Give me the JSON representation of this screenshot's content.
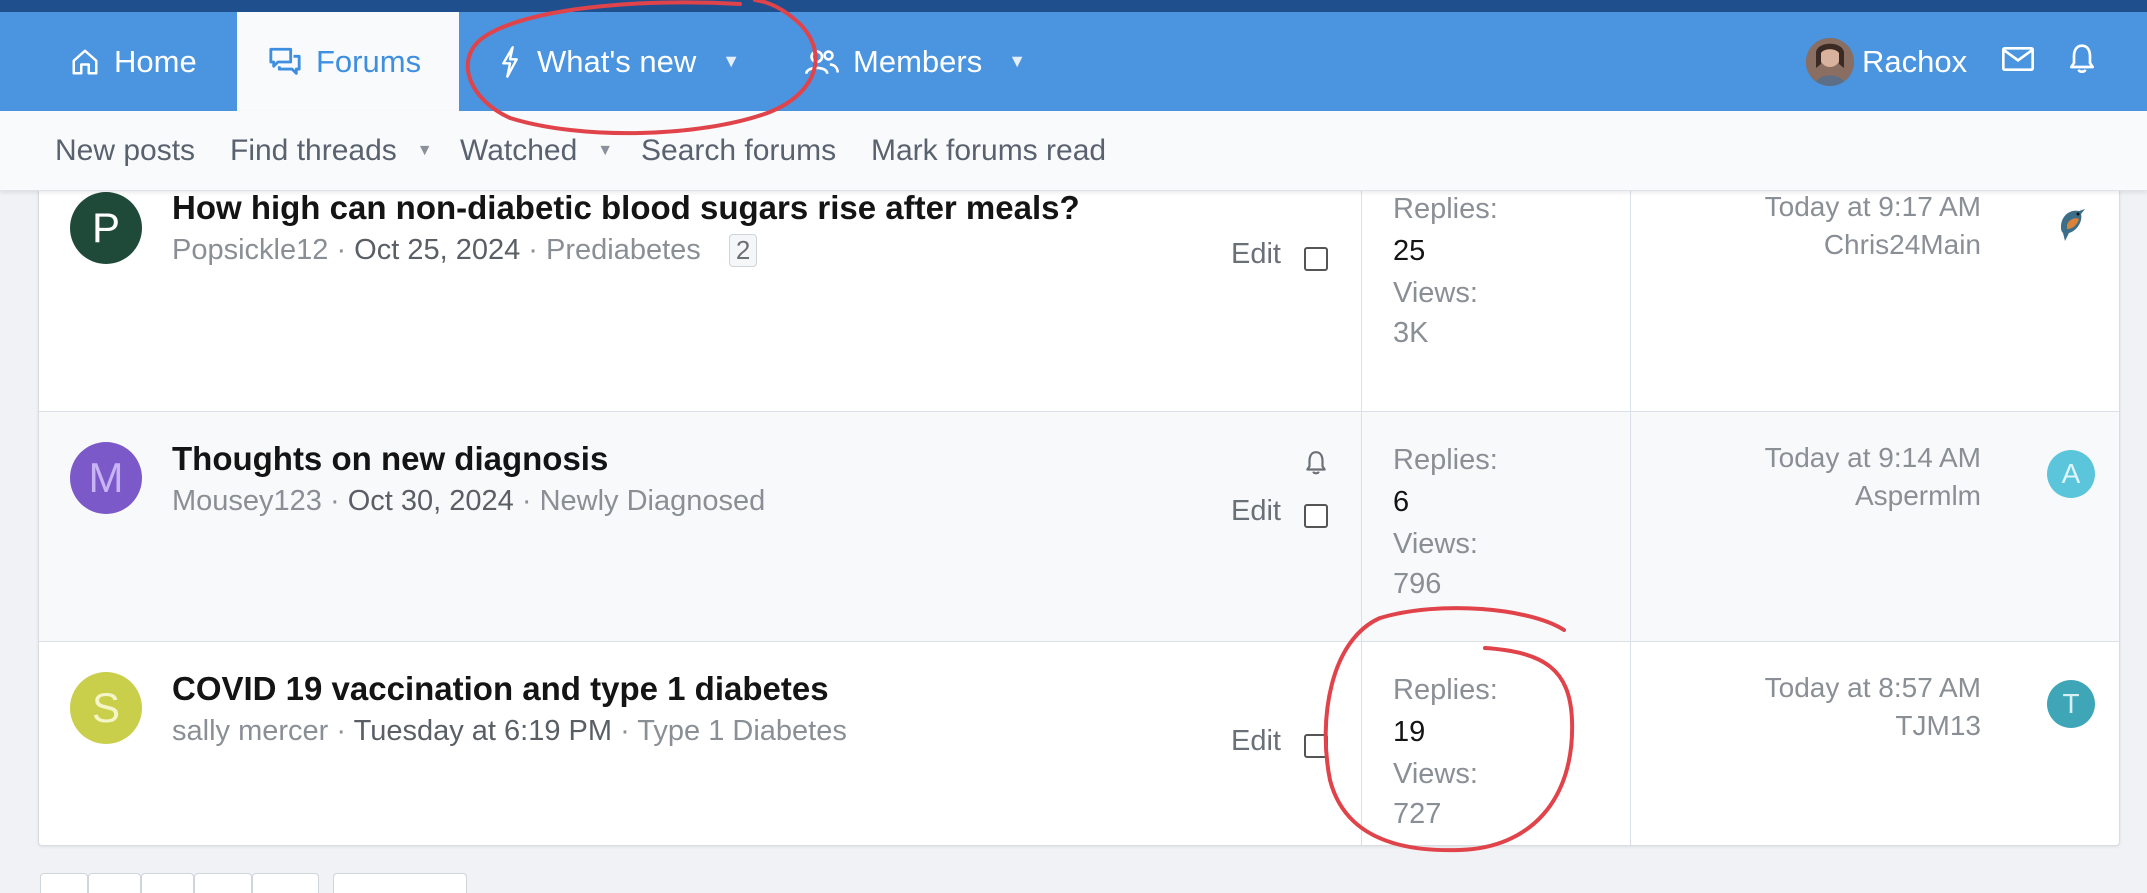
{
  "nav": {
    "tabs": [
      {
        "label": "Home",
        "icon": "home-icon"
      },
      {
        "label": "Forums",
        "icon": "forums-icon",
        "selected": true
      },
      {
        "label": "What's new",
        "icon": "bolt-icon"
      },
      {
        "label": "Members",
        "icon": "members-icon"
      }
    ],
    "user": {
      "name": "Rachox"
    }
  },
  "subnav": {
    "items": [
      "New posts",
      "Find threads",
      "Watched",
      "Search forums",
      "Mark forums read"
    ]
  },
  "threads": [
    {
      "avatar_letter": "P",
      "avatar_color": "#1f4a3a",
      "title": "How high can non-diabetic blood sugars rise after meals?",
      "author": "Popsickle12",
      "date": "Oct 25, 2024",
      "forum": "Prediabetes",
      "pages": "2",
      "edit": "Edit",
      "replies_label": "Replies:",
      "replies": "25",
      "views_label": "Views:",
      "views": "3K",
      "last_time": "Today at 9:17 AM",
      "last_user": "Chris24Main"
    },
    {
      "avatar_letter": "M",
      "avatar_color": "#7b59c9",
      "title": "Thoughts on new diagnosis",
      "author": "Mousey123",
      "date": "Oct 30, 2024",
      "forum": "Newly Diagnosed",
      "edit": "Edit",
      "replies_label": "Replies:",
      "replies": "6",
      "views_label": "Views:",
      "views": "796",
      "last_time": "Today at 9:14 AM",
      "last_user": "Aspermlm",
      "last_avatar_letter": "A",
      "last_avatar_color": "#5bc5dc"
    },
    {
      "avatar_letter": "S",
      "avatar_color": "#c9cf4a",
      "title": "COVID 19 vaccination and type 1 diabetes",
      "author": "sally mercer",
      "date": "Tuesday at 6:19 PM",
      "forum": "Type 1 Diabetes",
      "edit": "Edit",
      "replies_label": "Replies:",
      "replies": "19",
      "views_label": "Views:",
      "views": "727",
      "last_time": "Today at 8:57 AM",
      "last_user": "TJM13",
      "last_avatar_letter": "T",
      "last_avatar_color": "#3fa6b8"
    }
  ],
  "colors": {
    "nav_bg": "#4a94e0",
    "top_strip": "#1f4f8d",
    "annotation": "#e0434a"
  }
}
